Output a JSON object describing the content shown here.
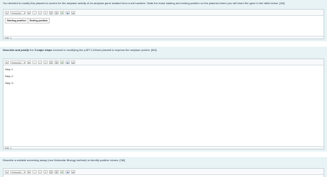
{
  "q1": {
    "text": "You decided to modify this plasmid to screen for the amylase activity of an amylase gene isolated from a soil bacteria. State the exact starting and ending position on the plasmid where you will insert the gene in the table below. [1M]",
    "table_headers": [
      "Starting position",
      "Ending position"
    ],
    "status": "Path: p"
  },
  "q2": {
    "text_prefix": "Describe and justify",
    "text_middle": " the ",
    "text_bold": "3 major steps",
    "text_suffix": " involved in modifying the pJET1.2/blunt plasmid to express the amylase protein. [6M]",
    "steps": [
      "Step 1:",
      "Step 2:",
      "Step 3:"
    ],
    "status": "Path: p"
  },
  "q3": {
    "text": "Describe a suitable screening assay (non Molecular Biology method) to identify positive clones. [3M]"
  },
  "toolbar": {
    "paragraph_select": "Paragraph",
    "bold": "B",
    "italic": "I",
    "bullet_list": "≡",
    "numbered_list": "≡",
    "link": "⛓",
    "unlink": "⛓",
    "special": "✱",
    "image": "▣",
    "media": "▤"
  }
}
